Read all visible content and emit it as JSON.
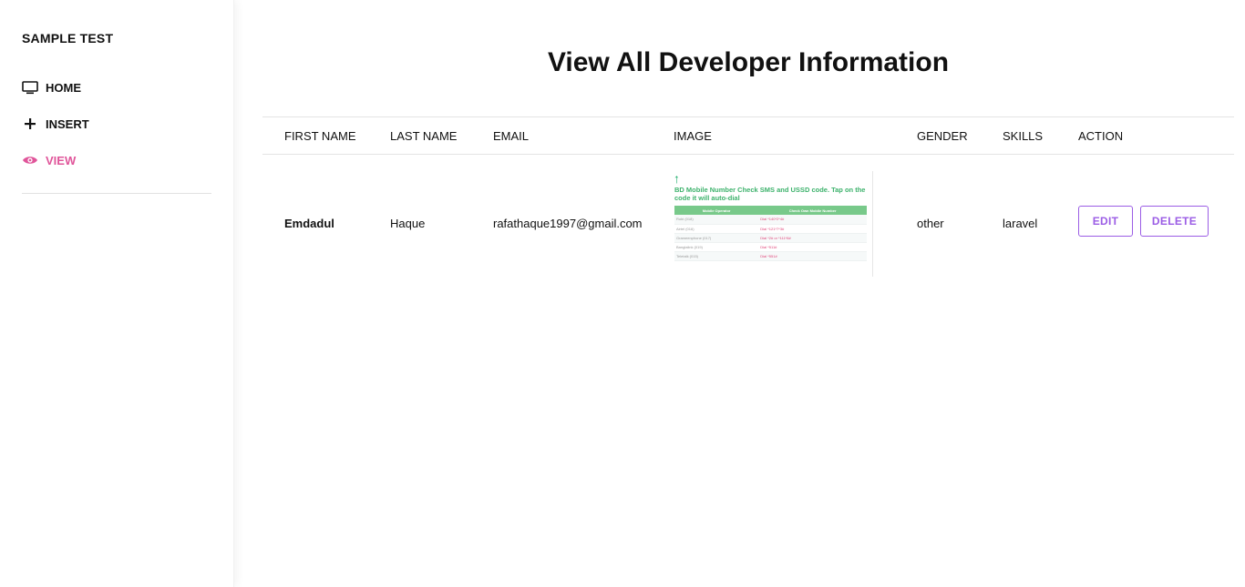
{
  "sidebar": {
    "brand": "SAMPLE TEST",
    "items": [
      {
        "label": "HOME",
        "icon": "monitor-icon",
        "active": false
      },
      {
        "label": "INSERT",
        "icon": "plus-icon",
        "active": false
      },
      {
        "label": "VIEW",
        "icon": "eye-icon",
        "active": true
      }
    ],
    "active_color": "#e0559a"
  },
  "main": {
    "title": "View All Developer Information",
    "columns": [
      "FIRST NAME",
      "LAST NAME",
      "EMAIL",
      "IMAGE",
      "GENDER",
      "SKILLS",
      "ACTION"
    ],
    "rows": [
      {
        "first_name": "Emdadul",
        "last_name": "Haque",
        "email": "rafathaque1997@gmail.com",
        "image": {
          "caption": "BD Mobile Number Check SMS and USSD code. Tap on the code it will auto-dial",
          "table_headers": [
            "Mobile Operator",
            "Check Own Mobile Number"
          ],
          "table_rows": [
            [
              "Robi (018)",
              "Dial *140*2*4#"
            ],
            [
              "Airtel (016)",
              "Dial *121*7*3#"
            ],
            [
              "Grameenphone (017)",
              "Dial *2# or *111*8#"
            ],
            [
              "Banglalink (019)",
              "Dial *511#"
            ],
            [
              "Teletalk (015)",
              "Dial *551#"
            ]
          ]
        },
        "gender": "other",
        "skills": "laravel",
        "actions": {
          "edit": "EDIT",
          "delete": "DELETE"
        }
      }
    ]
  },
  "colors": {
    "accent": "#9b5de5",
    "caption_green": "#3db26c"
  }
}
